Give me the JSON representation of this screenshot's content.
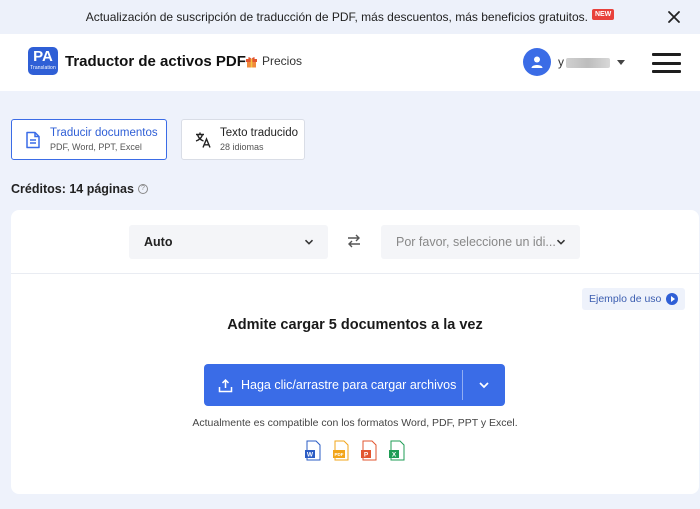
{
  "announcement": {
    "text": "Actualización de suscripción de traducción de PDF, más descuentos, más beneficios gratuitos.",
    "badge": "NEW"
  },
  "header": {
    "logo_text": "PA",
    "logo_sub": "Translation",
    "brand": "Traductor de activos PDF",
    "pricing_label": "Precios",
    "username": "y"
  },
  "tabs": [
    {
      "title": "Traducir documentos",
      "subtitle": "PDF, Word, PPT, Excel"
    },
    {
      "title": "Texto traducido",
      "subtitle": "28 idiomas"
    }
  ],
  "credits": {
    "label": "Créditos: 14 páginas",
    "help": "?"
  },
  "languages": {
    "source": "Auto",
    "target_placeholder": "Por favor, seleccione un idi..."
  },
  "example_label": "Ejemplo de uso",
  "headline": "Admite cargar 5 documentos a la vez",
  "upload_label": "Haga clic/arrastre para cargar archivos",
  "formats_text": "Actualmente es compatible con los formatos Word, PDF, PPT y Excel.",
  "colors": {
    "accent": "#3a6ce7",
    "word": "#2b5cc4",
    "pdf": "#f2a51a",
    "ppt": "#e2552f",
    "excel": "#1f9d55"
  },
  "file_icons": [
    "word-icon",
    "pdf-icon",
    "ppt-icon",
    "excel-icon"
  ]
}
